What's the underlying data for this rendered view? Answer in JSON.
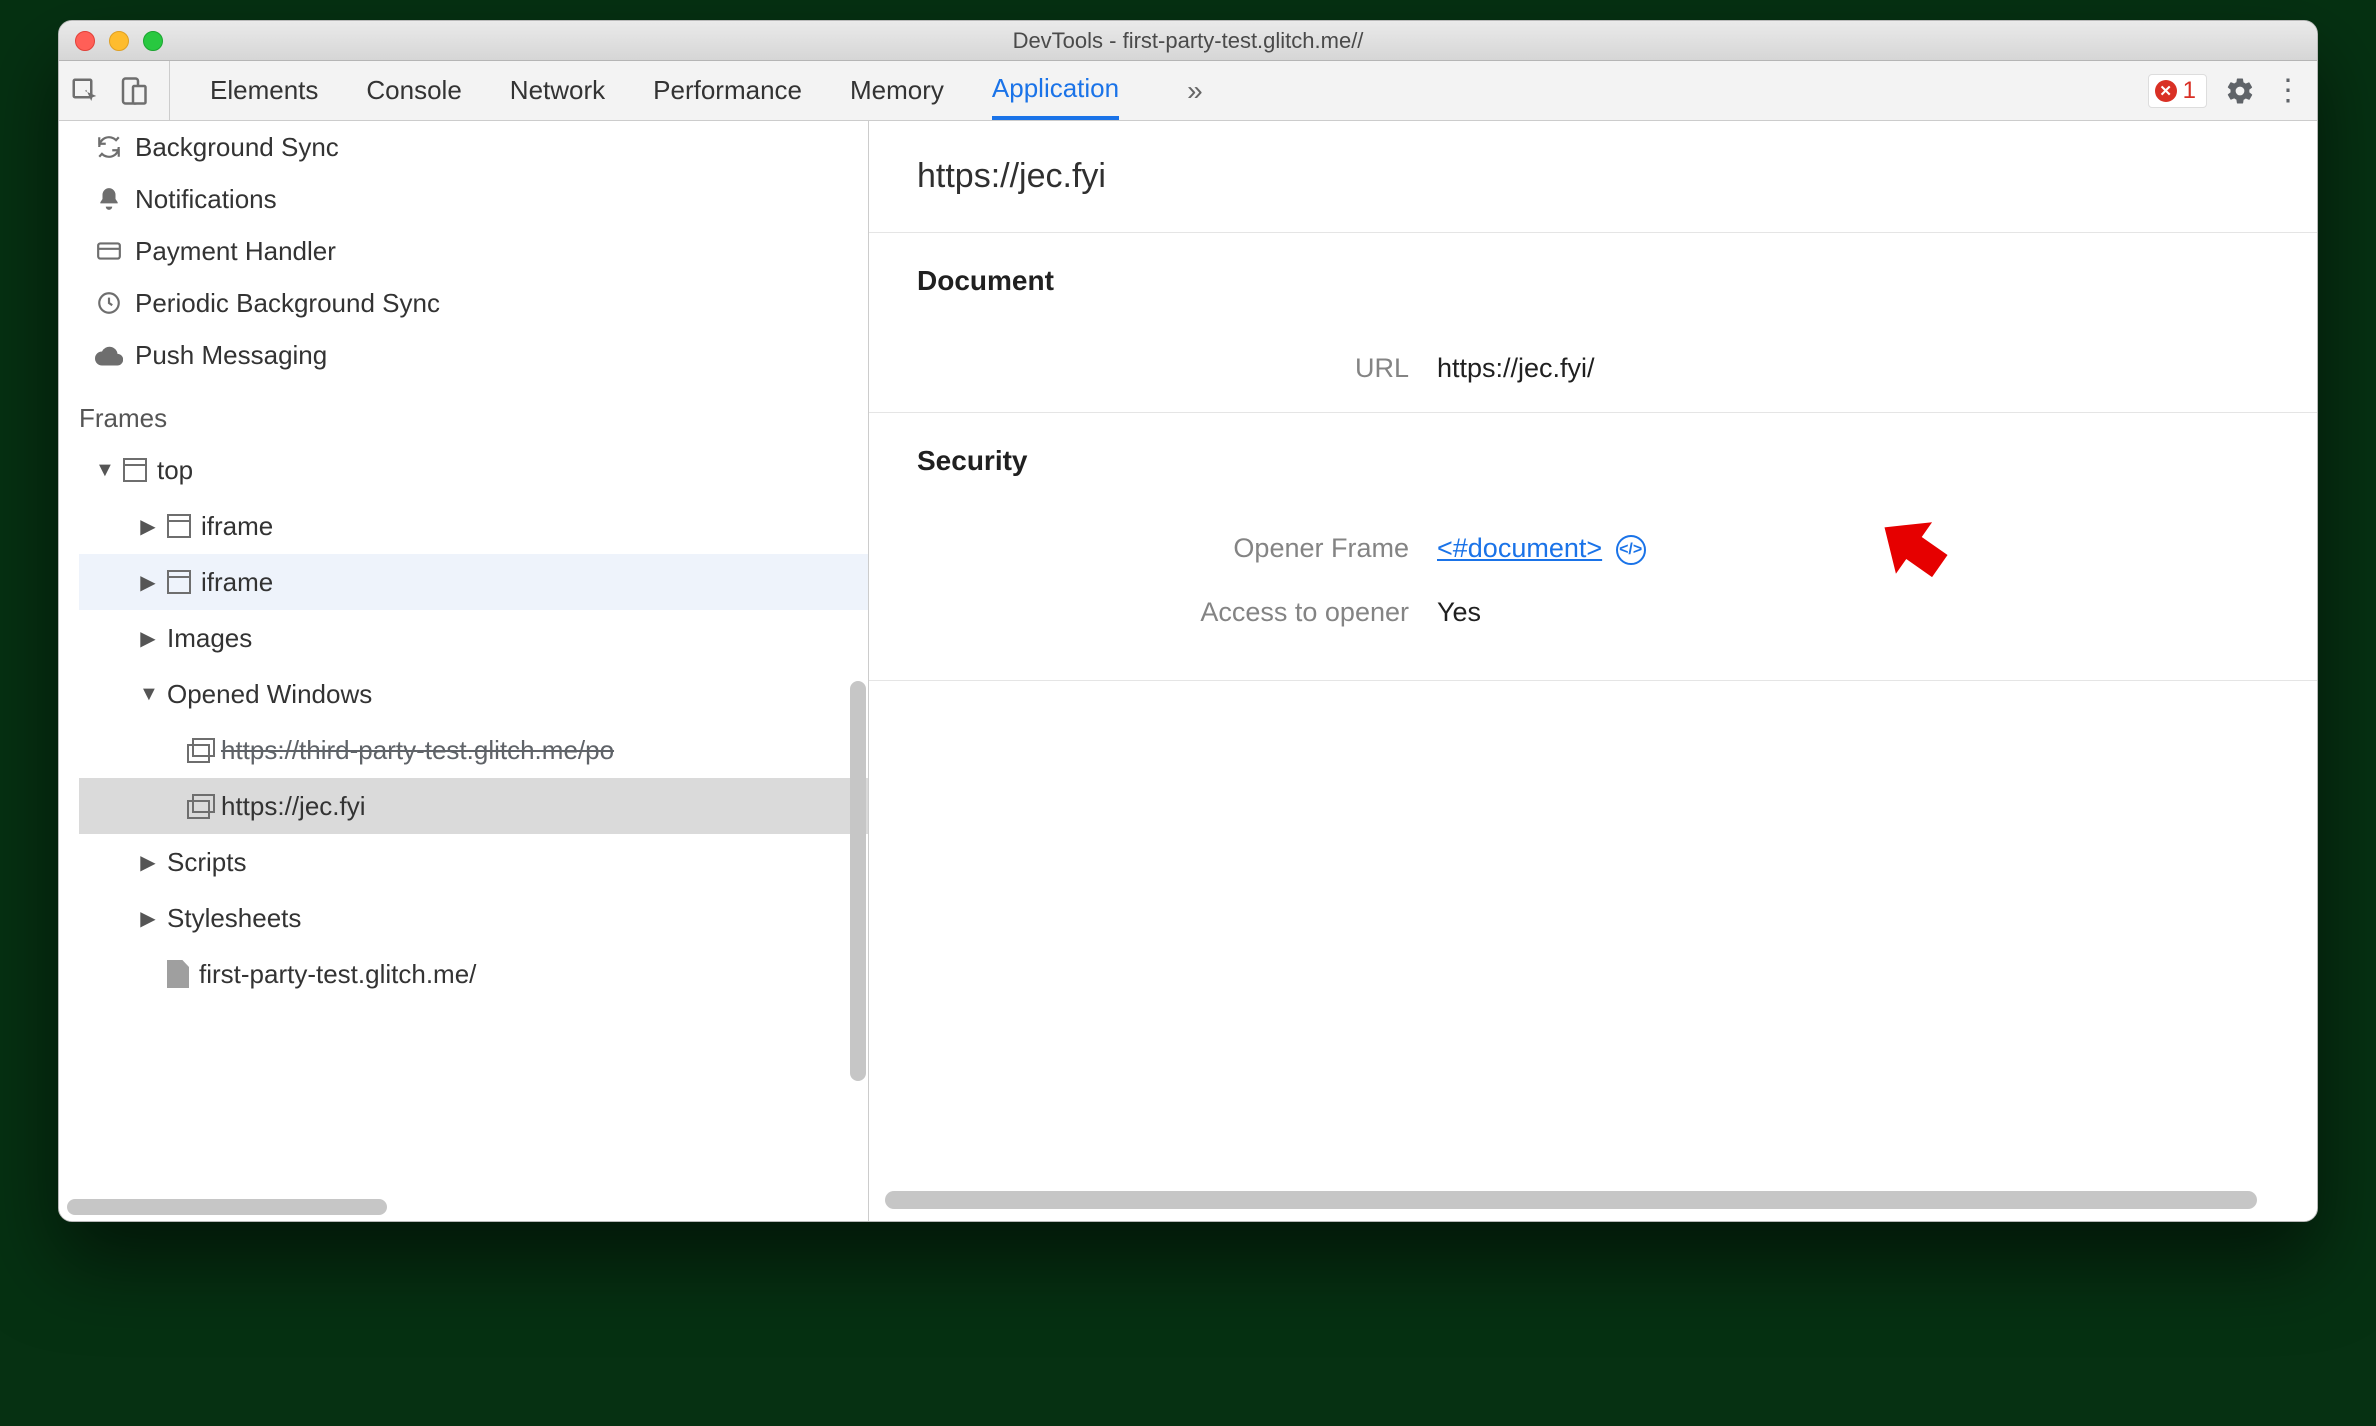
{
  "window": {
    "title": "DevTools - first-party-test.glitch.me//"
  },
  "toolbar": {
    "tabs": {
      "elements": "Elements",
      "console": "Console",
      "network": "Network",
      "performance": "Performance",
      "memory": "Memory",
      "application": "Application"
    },
    "errors": "1"
  },
  "sidebar": {
    "items": {
      "background_sync": "Background Sync",
      "notifications": "Notifications",
      "payment_handler": "Payment Handler",
      "periodic_bg_sync": "Periodic Background Sync",
      "push_messaging": "Push Messaging"
    },
    "frames": {
      "heading": "Frames",
      "top": "top",
      "iframe1": "iframe",
      "iframe2": "iframe",
      "images": "Images",
      "opened_windows": "Opened Windows",
      "win1": "https://third-party-test.glitch.me/po",
      "win2": "https://jec.fyi",
      "scripts": "Scripts",
      "stylesheets": "Stylesheets",
      "doc": "first-party-test.glitch.me/"
    }
  },
  "detail": {
    "heading": "https://jec.fyi",
    "document": {
      "title": "Document",
      "url_label": "URL",
      "url_value": "https://jec.fyi/"
    },
    "security": {
      "title": "Security",
      "opener_label": "Opener Frame",
      "opener_value": "<#document>",
      "access_label": "Access to opener",
      "access_value": "Yes"
    }
  }
}
